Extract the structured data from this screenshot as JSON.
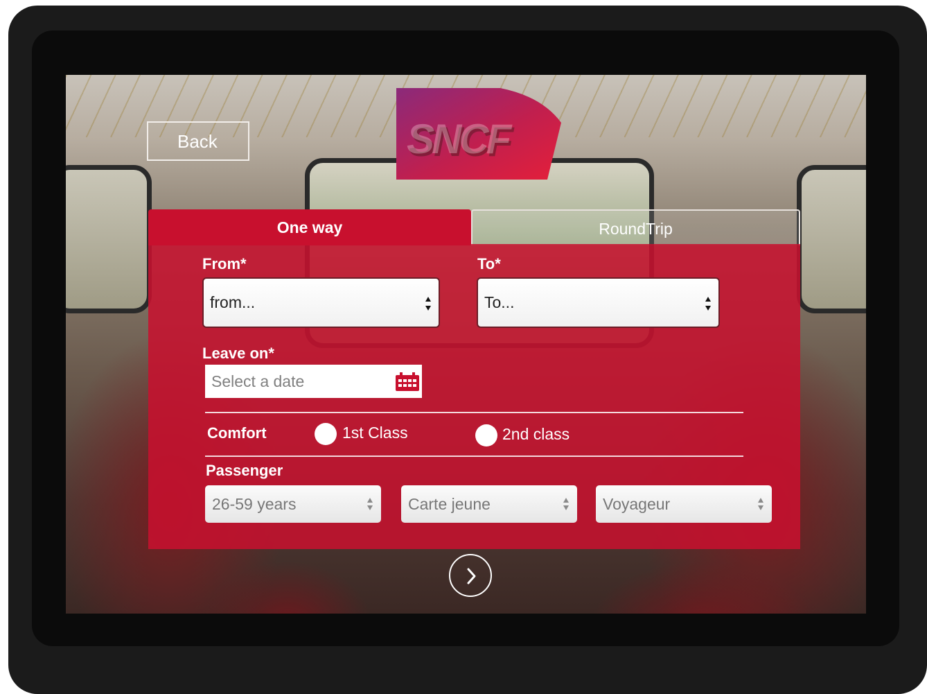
{
  "header": {
    "back_label": "Back",
    "logo_text": "SNCF"
  },
  "tabs": [
    {
      "label": "One way",
      "active": true
    },
    {
      "label": "RoundTrip",
      "active": false
    }
  ],
  "form": {
    "from_label": "From*",
    "from_value": "from...",
    "to_label": "To*",
    "to_value": "To...",
    "leave_label": "Leave on*",
    "date_placeholder": "Select a date",
    "comfort_label": "Comfort",
    "comfort_options": [
      "1st Class",
      "2nd class"
    ],
    "passenger_label": "Passenger",
    "passenger_selects": [
      "26-59 years",
      "Carte jeune",
      "Voyageur"
    ]
  },
  "icons": {
    "calendar": "calendar-icon",
    "next": "chevron-right-icon",
    "select_arrows": "select-arrows-icon"
  },
  "colors": {
    "brand_red": "#c8102e",
    "logo_gradient_start": "#8b2a7a",
    "logo_gradient_end": "#e41f3a"
  }
}
